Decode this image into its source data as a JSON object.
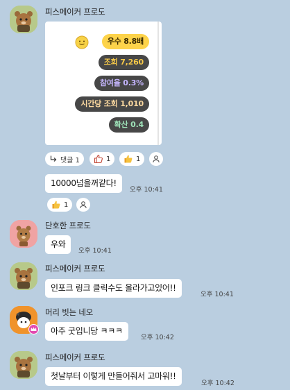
{
  "messages": {
    "m1": {
      "sender": "피스메이커 프로도",
      "stats": {
        "rank": "우수 8.8배",
        "views": "조회 7,260",
        "participation": "참여율 0.3%",
        "hourly_views": "시간당 조회 1,010",
        "spread": "확산 0.4"
      },
      "reactions": {
        "reply": "댓글 1",
        "thumb_outline_count": "1",
        "thumb_count": "1"
      }
    },
    "m2": {
      "text": "10000넘을꺼같다!",
      "time": "오후 10:41",
      "thumb_count": "1"
    },
    "m3": {
      "sender": "단호한 프로도",
      "text": "우와",
      "time": "오후 10:41"
    },
    "m4": {
      "sender": "피스메이커 프로도",
      "text": "인포크 링크 클릭수도 올라가고있어!!",
      "time": "오후 10:41"
    },
    "m5": {
      "sender": "머리 빗는 네오",
      "text": "아주 굿입니당 ㅋㅋㅋ",
      "time": "오후 10:42"
    },
    "m6": {
      "sender": "피스메이커 프로도",
      "text": "첫날부터 이렇게 만들어줘서 고마워!!",
      "time": "오후 10:42"
    }
  },
  "colors": {
    "background": "#bacee0",
    "rank_pill": "#fdd34a",
    "dark_pill": "#474747",
    "views_text": "#f7c948",
    "participation_text": "#c4b5fd",
    "hourly_text": "#fcd9a0",
    "spread_text": "#9ee2b8"
  },
  "icons": {
    "reply": "reply-arrow-icon",
    "thumb_outline": "thumbs-up-outline-icon",
    "thumb": "thumbs-up-emoji-icon",
    "add_reaction": "add-person-reaction-icon",
    "rank_face": "smiley-face-icon",
    "crown": "crown-badge-icon"
  }
}
